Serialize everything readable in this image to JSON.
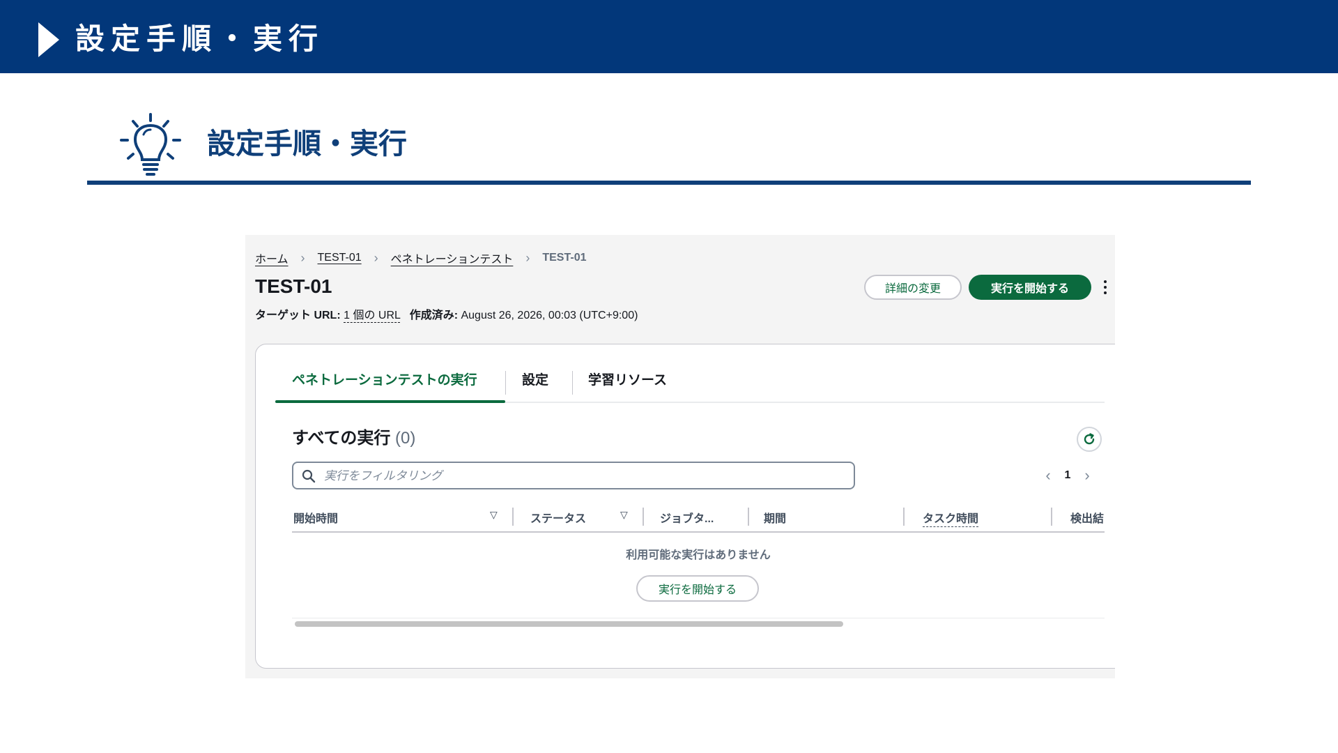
{
  "banner": {
    "title": "設定手順・実行"
  },
  "section": {
    "title": "設定手順・実行",
    "icon": "lightbulb-icon"
  },
  "console": {
    "breadcrumbs": [
      "ホーム",
      "TEST-01",
      "ペネトレーションテスト",
      "TEST-01"
    ],
    "title": "TEST-01",
    "meta": {
      "target_label": "ターゲット URL:",
      "target_value": "1 個の URL",
      "created_label": "作成済み:",
      "created_value": "August 26, 2026, 00:03 (UTC+9:00)"
    },
    "actions": {
      "edit_label": "詳細の変更",
      "start_label": "実行を開始する"
    },
    "tabs": [
      "ペネトレーションテストの実行",
      "設定",
      "学習リソース"
    ],
    "active_tab": 0,
    "list": {
      "title": "すべての実行",
      "count": "(0)",
      "search_placeholder": "実行をフィルタリング",
      "page": "1",
      "columns": [
        "開始時間",
        "ステータス",
        "ジョブタ...",
        "期間",
        "タスク時間",
        "検出結"
      ],
      "empty_text": "利用可能な実行はありません",
      "empty_button": "実行を開始する",
      "scroll_fraction": 0.68
    },
    "colors": {
      "accent": "#0b6a3e",
      "banner": "#02377a",
      "heading": "#0f3f79"
    }
  }
}
